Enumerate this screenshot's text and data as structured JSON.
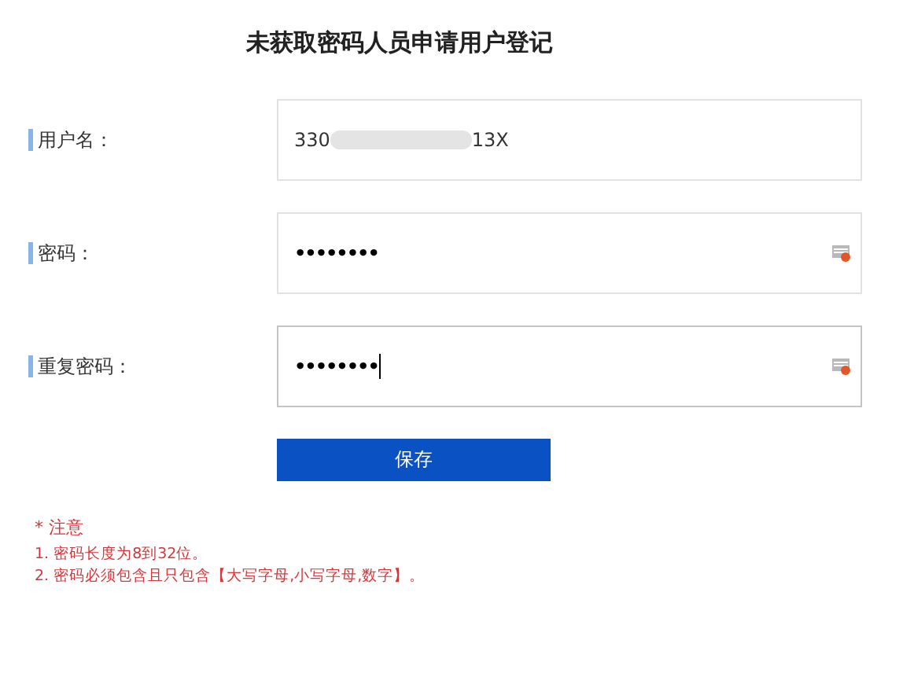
{
  "title": "未获取密码人员申请用户登记",
  "fields": [
    {
      "kind": "text",
      "label": "用户名：",
      "value_prefix": "330",
      "value_suffix": "13X",
      "redacted": true
    },
    {
      "kind": "password",
      "label": "密码：",
      "value": "••••••••",
      "focused": false
    },
    {
      "kind": "password",
      "label": "重复密码：",
      "value": "••••••••",
      "focused": true
    }
  ],
  "save_button": "保存",
  "notes": {
    "heading": "* 注意",
    "items": [
      "1. 密码长度为8到32位。",
      "2. 密码必须包含且只包含【大写字母,小写字母,数字】。"
    ]
  }
}
